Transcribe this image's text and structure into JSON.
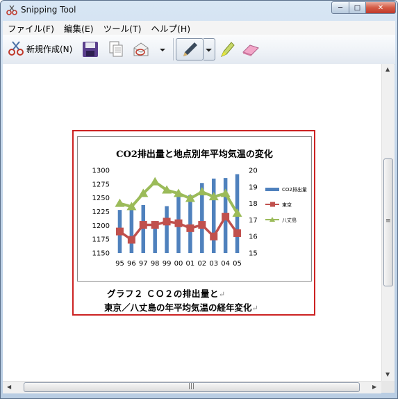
{
  "window": {
    "title": "Snipping Tool"
  },
  "window_buttons": {
    "minimize": "─",
    "maximize": "□",
    "close": "✕"
  },
  "menu": [
    {
      "label": "ファイル(F)"
    },
    {
      "label": "編集(E)"
    },
    {
      "label": "ツール(T)"
    },
    {
      "label": "ヘルプ(H)"
    }
  ],
  "toolbar": {
    "new_label": "新規作成(N)",
    "icons": [
      "save-icon",
      "copy-icon",
      "send-email-icon",
      "send-dropdown-arrow",
      "pen-icon",
      "pen-dropdown-arrow",
      "highlighter-icon",
      "eraser-icon"
    ]
  },
  "snip": {
    "caption_line1": "グラフ２ ＣＯ２の排出量と",
    "caption_line2": "東京／八丈島の年平均気温の経年変化",
    "return_mark": "↵"
  },
  "chart_data": {
    "type": "bar+line",
    "title": "CO2排出量と地点別年平均気温の変化",
    "categories": [
      "95",
      "96",
      "97",
      "98",
      "99",
      "00",
      "01",
      "02",
      "03",
      "04",
      "05"
    ],
    "left_axis": {
      "ylim": [
        1150,
        1300
      ],
      "ticks": [
        "1150",
        "1175",
        "1200",
        "1225",
        "1250",
        "1275",
        "1300"
      ]
    },
    "right_axis": {
      "ylim": [
        15,
        20
      ],
      "ticks": [
        "15",
        "16",
        "17",
        "18",
        "19",
        "20"
      ]
    },
    "series": [
      {
        "name": "CO2排出量",
        "kind": "bar",
        "axis": "left",
        "color": "#4f81bd",
        "values": [
          1228,
          1233,
          1237,
          1207,
          1235,
          1252,
          1255,
          1277,
          1285,
          1286,
          1293
        ]
      },
      {
        "name": "東京",
        "kind": "line",
        "axis": "right",
        "color": "#c0504d",
        "marker": "square",
        "values": [
          16.3,
          15.8,
          16.7,
          16.7,
          16.9,
          16.8,
          16.5,
          16.7,
          16.0,
          17.2,
          16.2
        ]
      },
      {
        "name": "八丈島",
        "kind": "line",
        "axis": "right",
        "color": "#9bbb59",
        "marker": "triangle",
        "values": [
          18.0,
          17.8,
          18.6,
          19.3,
          18.8,
          18.6,
          18.3,
          18.7,
          18.4,
          18.6,
          17.4
        ]
      }
    ],
    "legend": "right",
    "grid": false
  },
  "colors": {
    "snip_border": "#cc2222",
    "accent": "#4f81bd"
  }
}
